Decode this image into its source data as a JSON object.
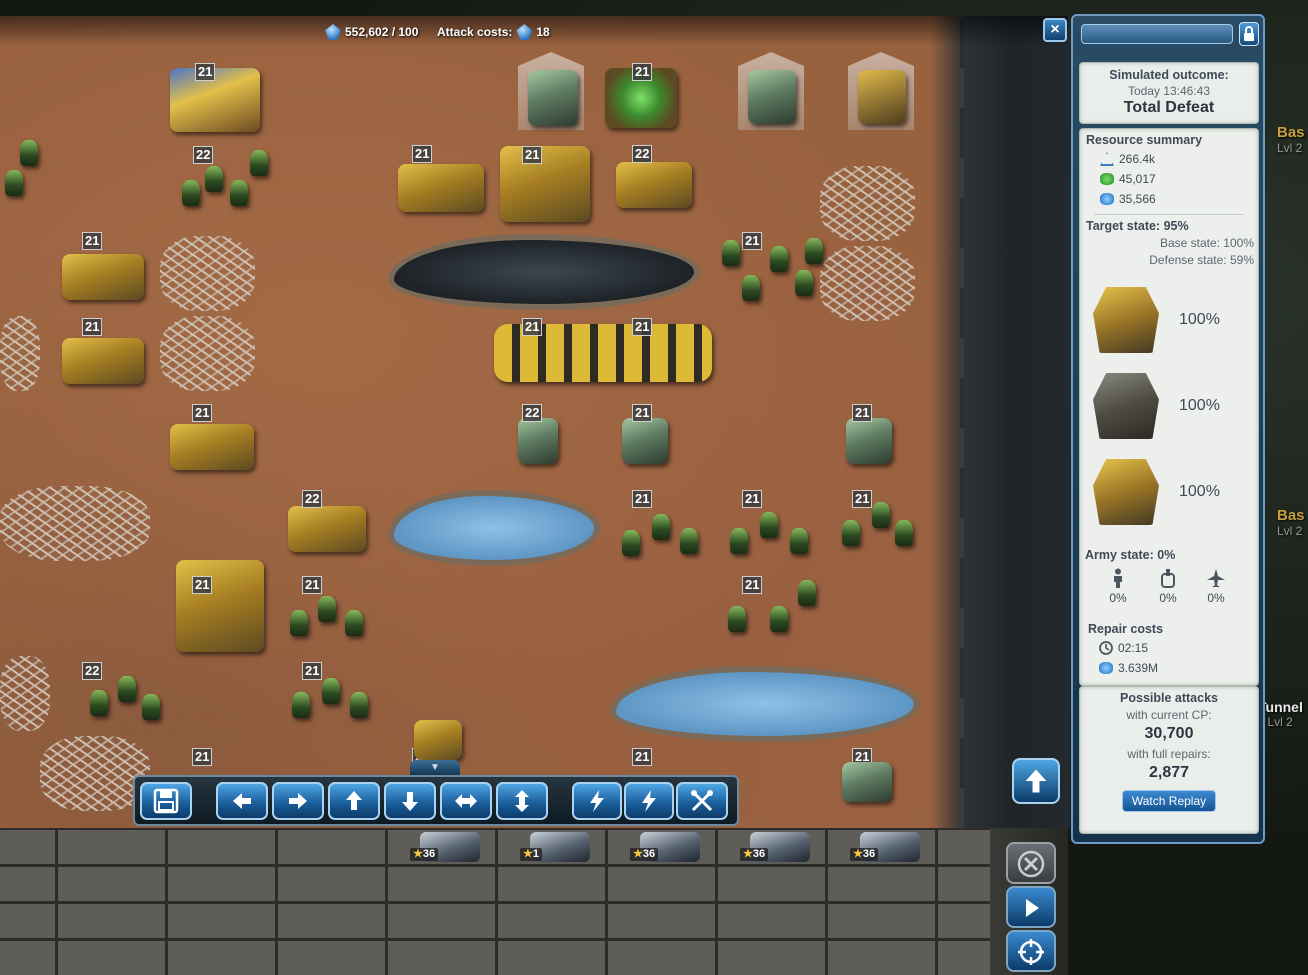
{
  "topbar": {
    "cp_value": "552,602 / 100",
    "attack_costs_label": "Attack costs:",
    "attack_costs_value": "18"
  },
  "close_label": "×",
  "units": {
    "level_21": "21",
    "level_22": "22"
  },
  "toolbar": {
    "save_icon": "save-icon",
    "left_icon": "arrow-left-icon",
    "right_icon": "arrow-right-icon",
    "up_icon": "arrow-up-icon",
    "down_icon": "arrow-down-icon",
    "horizontal_icon": "arrows-horizontal-icon",
    "vertical_icon": "arrows-vertical-icon",
    "bolt_icon": "lightning-icon",
    "tools_icon": "tools-icon",
    "collapse_label": "▼"
  },
  "tray": {
    "units": [
      {
        "star": "★",
        "level": "36"
      },
      {
        "star": "★",
        "level": "1"
      },
      {
        "star": "★",
        "level": "36"
      },
      {
        "star": "★",
        "level": "36"
      },
      {
        "star": "★",
        "level": "36"
      }
    ]
  },
  "panel": {
    "outcome_label": "Simulated outcome:",
    "outcome_time": "Today 13:46:43",
    "outcome_result": "Total Defeat",
    "resource_summary_label": "Resource summary",
    "resources": {
      "cp": "266.4k",
      "tiberium": "45,017",
      "crystal": "35,566"
    },
    "target_state_label": "Target state: 95%",
    "base_state_label": "Base state: 100%",
    "defense_state_label": "Defense state: 59%",
    "buildings": [
      {
        "name": "construction-yard",
        "pct": "100%"
      },
      {
        "name": "command-center",
        "pct": "100%"
      },
      {
        "name": "defense-facility",
        "pct": "100%"
      }
    ],
    "army_state_label": "Army state: 0%",
    "army": {
      "infantry": "0%",
      "vehicles": "0%",
      "aircraft": "0%"
    },
    "repair_costs_label": "Repair costs",
    "repair_time": "02:15",
    "repair_crystal": "3.639M",
    "possible_attacks_label": "Possible attacks",
    "with_current_cp_label": "with current CP:",
    "with_current_cp_value": "30,700",
    "with_full_repairs_label": "with full repairs:",
    "with_full_repairs_value": "2,877",
    "watch_replay_label": "Watch Replay"
  },
  "map_labels": {
    "base_a": "Bas",
    "base_a_lvl": "Lvl 2",
    "base_b": "Bas",
    "base_b_lvl": "Lvl 2",
    "tunnel": "Tunnel",
    "tunnel_lvl": "Lvl 2"
  },
  "colors": {
    "accent": "#1b5f9c",
    "panel_bg": "#16324a",
    "card_bg": "#eaeeea",
    "dirt": "#99623f"
  }
}
